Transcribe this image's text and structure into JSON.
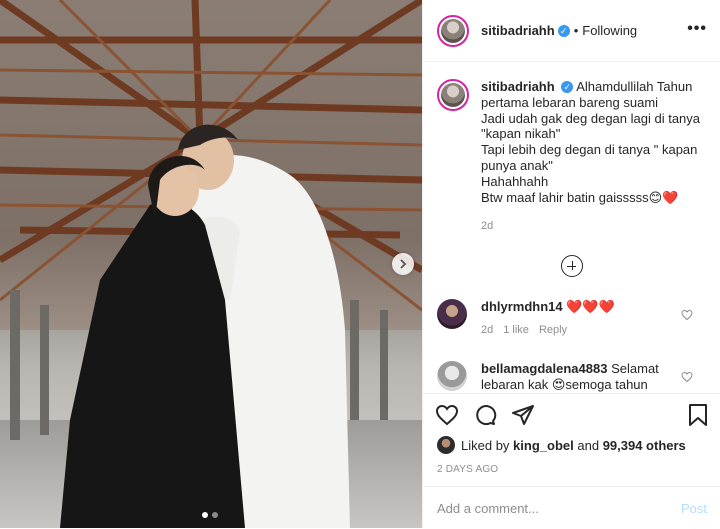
{
  "post": {
    "username": "sitibadriahh",
    "separator": "•",
    "follow_status": "Following",
    "more_label": "•••"
  },
  "caption": {
    "username": "sitibadriahh",
    "lines": [
      "Alhamdullilah Tahun",
      "pertama lebaran bareng suami",
      "Jadi udah gak deg degan lagi di tanya",
      "\"kapan nikah\"",
      "Tapi lebih deg degan di tanya \" kapan",
      "punya anak\"",
      "Hahahhahh",
      "Btw maaf lahir batin gaisssss😊❤️"
    ],
    "age": "2d"
  },
  "comments": [
    {
      "username": "dhlyrmdhn14",
      "text": "❤️❤️❤️",
      "age": "2d",
      "likes": "1 like",
      "reply": "Reply"
    },
    {
      "username": "bellamagdalena4883",
      "text": "Selamat lebaran kak 😍semoga tahun"
    }
  ],
  "likes": {
    "prefix": "Liked by",
    "user": "king_obel",
    "and": "and",
    "count": "99,394 others"
  },
  "date": "2 DAYS AGO",
  "add_comment": {
    "placeholder": "Add a comment...",
    "post_label": "Post"
  },
  "colors": {
    "accent_blue": "#3897f0",
    "post_disabled": "#b2dffc",
    "heart_red": "#ed4956"
  },
  "carousel": {
    "slides": 2,
    "active": 1
  }
}
